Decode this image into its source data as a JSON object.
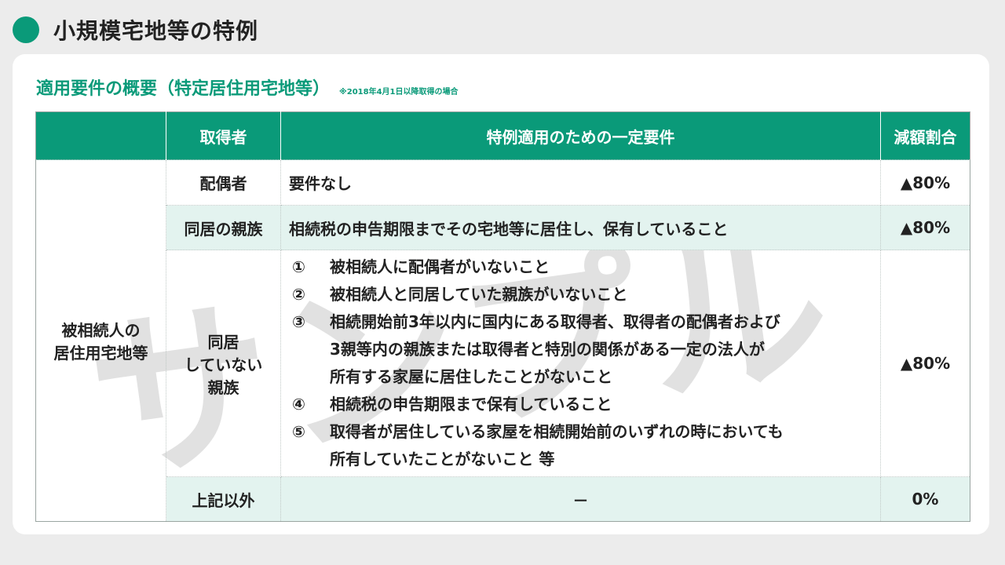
{
  "page": {
    "title": "小規模宅地等の特例",
    "subtitle": "適用要件の概要（特定居住用宅地等）",
    "note": "※2018年4月1日以降取得の場合",
    "watermark": "サンプル"
  },
  "colors": {
    "accent": "#0a9a79",
    "shade": "#e3f3ef",
    "background": "#ececec"
  },
  "table": {
    "headers": [
      "",
      "取得者",
      "特例適用のための一定要件",
      "減額割合"
    ],
    "category": "被相続人の居住用宅地等",
    "category_lines": [
      "被相続人の",
      "居住用宅地等"
    ],
    "rows": [
      {
        "acquirer": "配偶者",
        "requirement": "要件なし",
        "rate": "▲80%"
      },
      {
        "acquirer": "同居の親族",
        "requirement": "相続税の申告期限までその宅地等に居住し、保有していること",
        "rate": "▲80%"
      },
      {
        "acquirer_lines": [
          "同居",
          "していない",
          "親族"
        ],
        "requirements": [
          {
            "num": "①",
            "text": "被相続人に配偶者がいないこと"
          },
          {
            "num": "②",
            "text": "被相続人と同居していた親族がいないこと"
          },
          {
            "num": "③",
            "text_lines": [
              "相続開始前3年以内に国内にある取得者、取得者の配偶者および",
              "3親等内の親族または取得者と特別の関係がある一定の法人が",
              "所有する家屋に居住したことがないこと"
            ]
          },
          {
            "num": "④",
            "text": "相続税の申告期限まで保有していること"
          },
          {
            "num": "⑤",
            "text_lines": [
              "取得者が居住している家屋を相続開始前のいずれの時においても",
              "所有していたことがないこと 等"
            ]
          }
        ],
        "rate": "▲80%"
      },
      {
        "acquirer": "上記以外",
        "requirement": "－",
        "rate": "0%"
      }
    ]
  }
}
